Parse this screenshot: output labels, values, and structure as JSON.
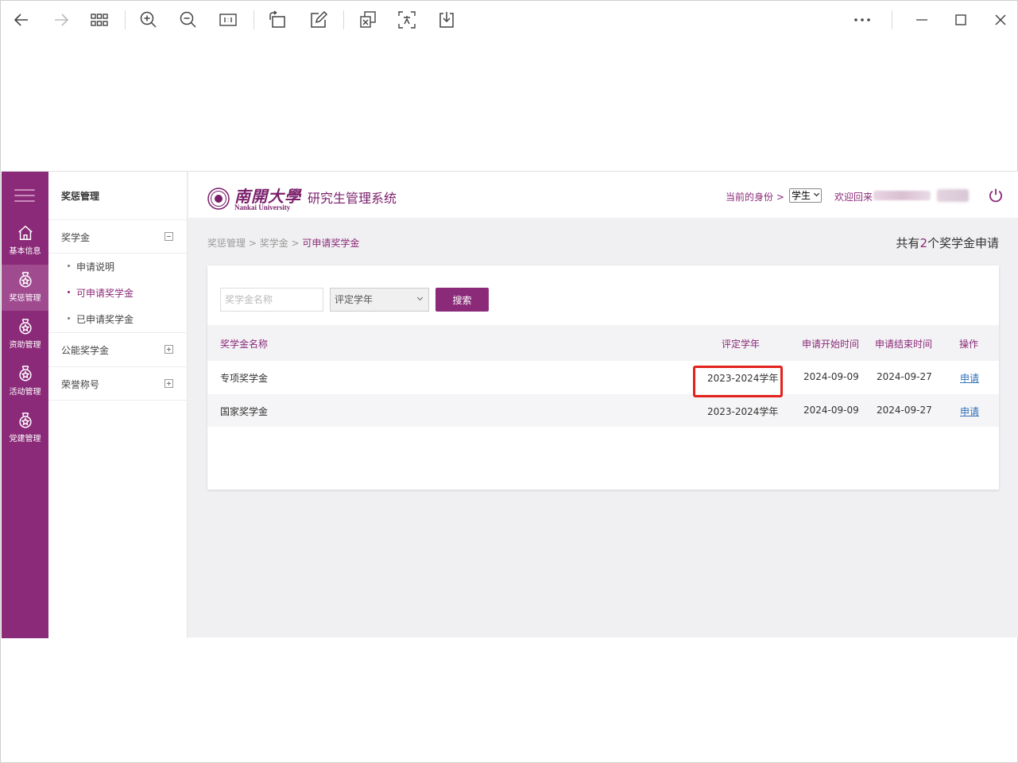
{
  "app": {
    "rail": {
      "items": [
        {
          "label": "基本信息",
          "icon": "home-icon"
        },
        {
          "label": "奖惩管理",
          "icon": "medal-icon"
        },
        {
          "label": "资助管理",
          "icon": "medal-icon"
        },
        {
          "label": "活动管理",
          "icon": "medal-icon"
        },
        {
          "label": "党建管理",
          "icon": "medal-icon"
        }
      ]
    },
    "sub_sidebar": {
      "title": "奖惩管理",
      "sections": [
        {
          "label": "奖学金",
          "children": [
            "申请说明",
            "可申请奖学金",
            "已申请奖学金"
          ]
        },
        {
          "label": "公能奖学金"
        },
        {
          "label": "荣誉称号"
        }
      ]
    },
    "header": {
      "logo_cn": "南開大學",
      "logo_en": "Nankai University",
      "system_title": "研究生管理系统",
      "identity_label": "当前的身份 >",
      "identity_value": "学生",
      "welcome": "欢迎回来"
    },
    "breadcrumb": {
      "items": [
        "奖惩管理",
        "奖学金"
      ],
      "separator": " > ",
      "current": "可申请奖学金"
    },
    "count": {
      "prefix": "共有",
      "number": "2",
      "suffix": "个奖学金申请"
    },
    "filters": {
      "name_placeholder": "奖学金名称",
      "year_placeholder": "评定学年",
      "search_label": "搜索"
    },
    "table": {
      "headers": [
        "奖学金名称",
        "评定学年",
        "申请开始时间",
        "申请结束时间",
        "操作"
      ],
      "rows": [
        {
          "name": "专项奖学金",
          "year": "2023-2024学年",
          "start": "2024-09-09",
          "end": "2024-09-27",
          "action": "申请"
        },
        {
          "name": "国家奖学金",
          "year": "2023-2024学年",
          "start": "2024-09-09",
          "end": "2024-09-27",
          "action": "申请"
        }
      ]
    }
  },
  "colors": {
    "brand": "#8b2a79",
    "link": "#3370b8",
    "highlight": "#e3221c"
  }
}
